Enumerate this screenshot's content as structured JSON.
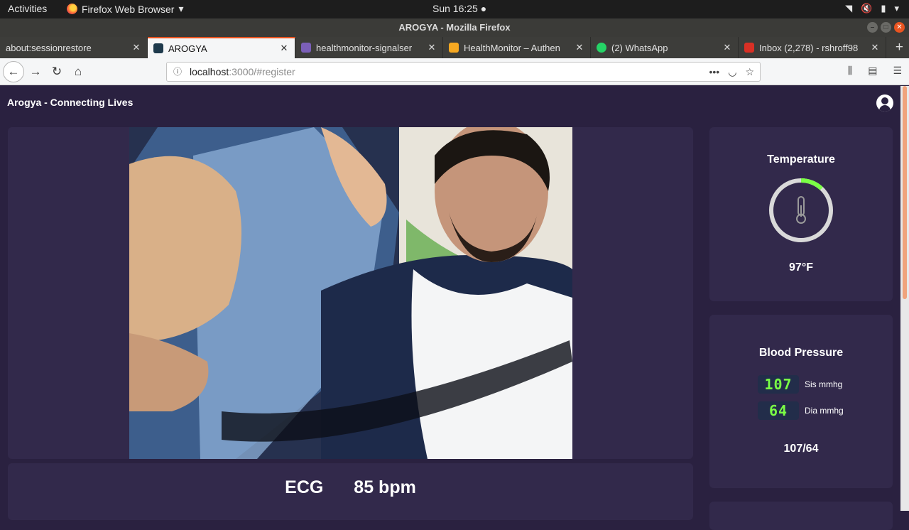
{
  "system": {
    "activities": "Activities",
    "app_name": "Firefox Web Browser",
    "clock": "Sun 16:25"
  },
  "window": {
    "title": "AROGYA - Mozilla Firefox"
  },
  "tabs": [
    {
      "label": "about:sessionrestore",
      "favicon_color": null
    },
    {
      "label": "AROGYA",
      "favicon_color": "#1e3a4c",
      "active": true
    },
    {
      "label": "healthmonitor-signalser",
      "favicon_color": "#7b5fb8"
    },
    {
      "label": "HealthMonitor – Authen",
      "favicon_color": "#f6a821"
    },
    {
      "label": "(2) WhatsApp",
      "favicon_color": "#25d366"
    },
    {
      "label": "Inbox (2,278) - rshroff98",
      "favicon_color": "#d93025"
    }
  ],
  "navbar": {
    "url_host": "localhost",
    "url_rest": ":3000/#register"
  },
  "app": {
    "title": "Arogya - Connecting Lives",
    "temperature": {
      "title": "Temperature",
      "value": "97°F",
      "gauge_fraction": 0.12,
      "accent": "#7aff45"
    },
    "blood_pressure": {
      "title": "Blood Pressure",
      "systolic": "107",
      "systolic_unit": "Sis mmhg",
      "diastolic": "64",
      "diastolic_unit": "Dia mmhg",
      "summary": "107/64"
    },
    "ecg": {
      "label": "ECG",
      "bpm": "85 bpm"
    }
  },
  "colors": {
    "background": "#2a2140",
    "card": "#32294b",
    "lcd_text": "#7aff45",
    "ubuntu_orange": "#e95420"
  }
}
